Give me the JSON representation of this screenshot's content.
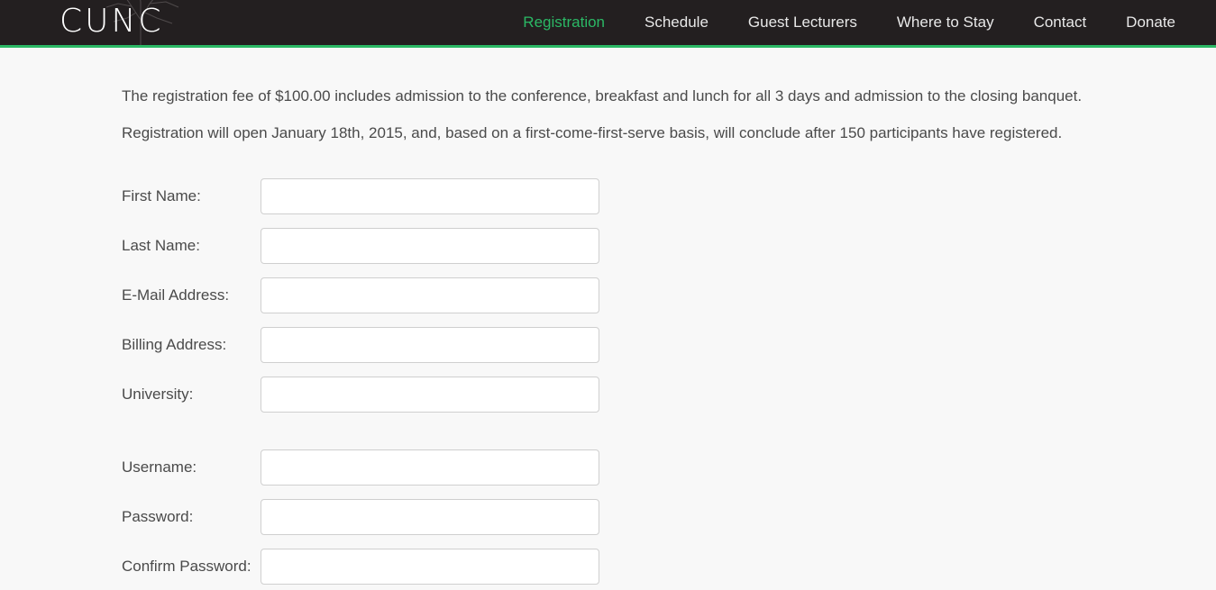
{
  "header": {
    "logo_text": "CUNC",
    "nav": [
      {
        "label": "Registration",
        "active": true
      },
      {
        "label": "Schedule"
      },
      {
        "label": "Guest Lecturers"
      },
      {
        "label": "Where to Stay"
      },
      {
        "label": "Contact"
      },
      {
        "label": "Donate"
      }
    ],
    "accent_color": "#2bb865",
    "bar_color": "#231f20"
  },
  "intro": {
    "fee_text": "The registration fee of $100.00 includes admission to the conference, breakfast and lunch for all 3 days and admission to the closing banquet.",
    "open_text": "Registration will open January 18th, 2015, and, based on a first-come-first-serve basis, will conclude after 150 participants have registered."
  },
  "form": {
    "first_name": {
      "label": "First Name:",
      "value": ""
    },
    "last_name": {
      "label": "Last Name:",
      "value": ""
    },
    "email": {
      "label": "E-Mail Address:",
      "value": ""
    },
    "billing": {
      "label": "Billing Address:",
      "value": ""
    },
    "university": {
      "label": "University:",
      "value": ""
    },
    "username": {
      "label": "Username:",
      "value": ""
    },
    "password": {
      "label": "Password:",
      "value": ""
    },
    "confirm_password": {
      "label": "Confirm Password:",
      "value": ""
    }
  }
}
